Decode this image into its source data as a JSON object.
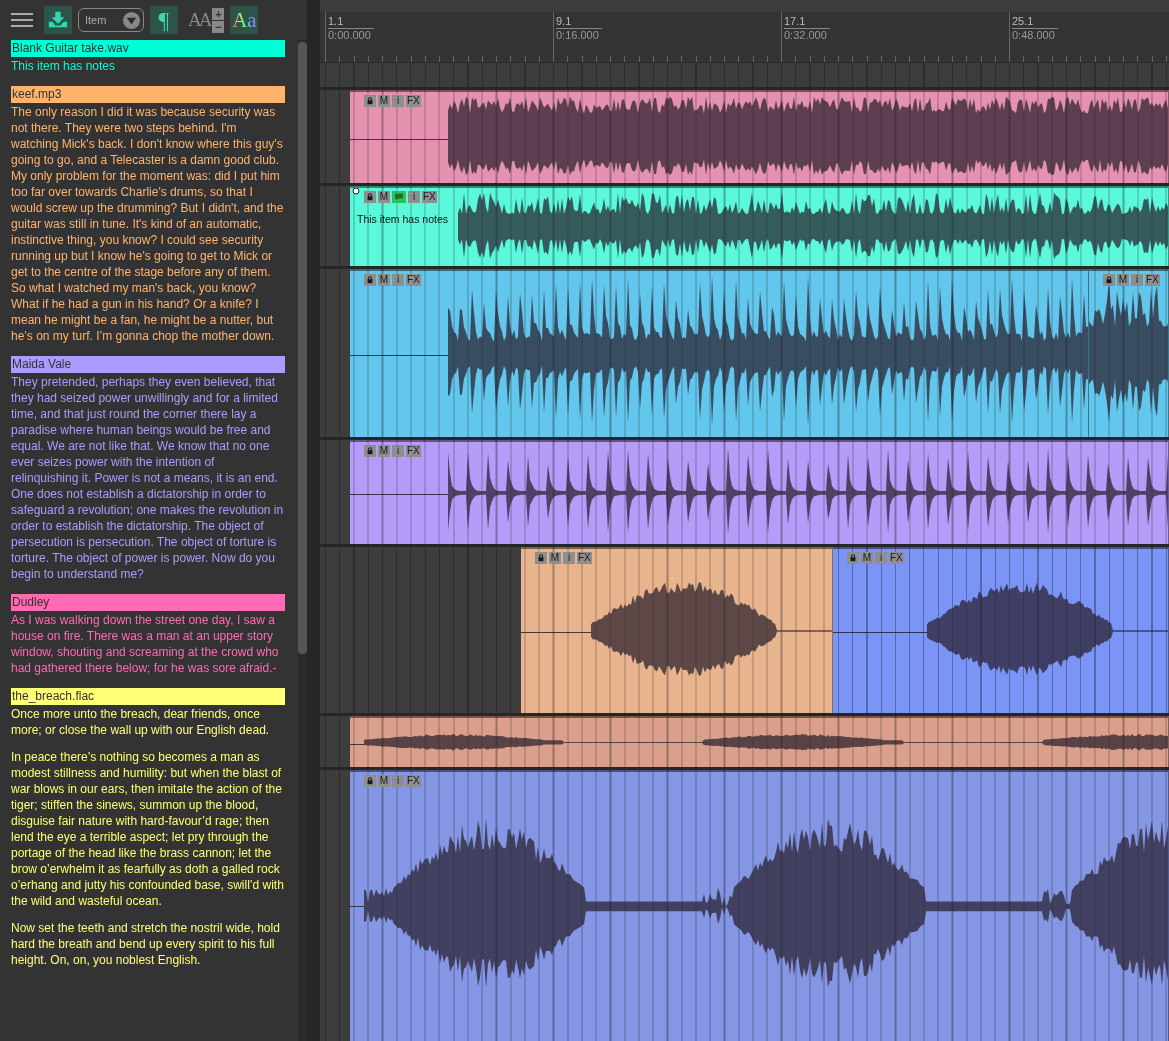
{
  "toolbar": {
    "dropdown": "Item",
    "pilcrow": "¶",
    "size_glyph": "AA",
    "increase": "+",
    "decrease": "−",
    "style_glyph": "Aa"
  },
  "notes": [
    {
      "title": "Blank Guitar take.wav",
      "color": "#00ffd8",
      "paragraphs": [
        "This item has notes"
      ]
    },
    {
      "title": "keef.mp3",
      "color": "#ffb46e",
      "paragraphs": [
        "The only reason I did it was because security was not there. They were two steps behind. I'm watching Mick's back. I don't know where this guy's going to go, and a Telecaster is a damn good club. My only problem for the moment was: did I put him too far over towards Charlie's drums, so that I would screw up the drumming? But I didn't, and the guitar was still in tune. It's kind of an automatic, instinctive thing, you know? I could see security running up but I know he's going to get to Mick or get to the centre of the stage before any of them. So what I watched my man's back, you know? What if he had a gun in his hand? Or a knife? I mean he might be a fan, he might be a nutter, but he’s on my turf. I’m gonna chop the mother down."
      ]
    },
    {
      "title": "Maida Vale",
      "color": "#aa9cff",
      "paragraphs": [
        "They pretended, perhaps they even believed, that they had seized power unwillingly and for a limited time, and that just round the corner there lay a paradise where human beings would be free and equal. We are not like that. We know that no one ever seizes power with the intention of relinquishing it. Power is not a means, it is an end. One does not establish a dictatorship in order to safeguard a revolution; one makes the revolution in order to establish the dictatorship. The object of persecution is persecution. The object of torture is torture. The object of power is power. Now do you begin to understand me?"
      ]
    },
    {
      "title": "Dudley",
      "color": "#ff6ab4",
      "paragraphs": [
        "As I was walking down the street one day, I saw a house on fire. There was a man at an upper story window, shouting and screaming at the crowd who had gathered there below; for he was sore afraid.-"
      ]
    },
    {
      "title": "the_breach.flac",
      "color": "#ffff78",
      "paragraphs": [
        "Once more unto the breach, dear friends, once more; or close the wall up with our English dead.",
        "In peace there’s nothing so becomes a man as modest stillness and humility: but when the blast of war blows in our ears, then imitate the action of the tiger; stiffen the sinews, summon up the blood, disguise fair nature with hard-favour’d rage; then lend the eye a terrible aspect; let pry through the portage of the head like the brass cannon; let the brow o’erwhelm it as fearfully as doth a galled rock o’erhang and jutty his confounded base, swill’d with the wild and wasteful ocean.",
        "Now set the teeth and stretch the nostril wide, hold hard the breath and bend up every spirit to his full height. On, on, you noblest English."
      ]
    }
  ],
  "ruler": [
    {
      "bar": "1.1",
      "time": "0:00.000"
    },
    {
      "bar": "9.1",
      "time": "0:16.000"
    },
    {
      "bar": "17.1",
      "time": "0:32.000"
    },
    {
      "bar": "25.1",
      "time": "0:48.000"
    }
  ],
  "tracks": [
    {
      "items": [
        {
          "color": "#e592b0",
          "buttons": [
            "M",
            "i",
            "FX"
          ],
          "notes": false
        }
      ]
    },
    {
      "items": [
        {
          "color": "#5cf8dc",
          "buttons": [
            "M",
            "i",
            "FX"
          ],
          "notes": true,
          "note_text": "This item has notes"
        }
      ]
    },
    {
      "items": [
        {
          "color": "#63c6ec",
          "buttons": [
            "M",
            "i",
            "FX"
          ],
          "notes": false
        },
        {
          "color": "#63c6ec",
          "buttons": [
            "M",
            "i",
            "FX"
          ],
          "notes": false
        }
      ]
    },
    {
      "items": [
        {
          "color": "#b59cf8",
          "buttons": [
            "M",
            "i",
            "FX"
          ],
          "notes": false
        }
      ]
    },
    {
      "items": [
        {
          "color": "#e8b48e",
          "buttons": [
            "M",
            "i",
            "FX"
          ],
          "notes": false
        },
        {
          "color": "#7b95f6",
          "buttons": [
            "M",
            "i",
            "FX"
          ],
          "notes": false
        }
      ]
    },
    {
      "items": [
        {
          "color": "#dba08c",
          "notes": false
        }
      ]
    },
    {
      "items": [
        {
          "color": "#8597e4",
          "buttons": [
            "M",
            "i",
            "FX"
          ],
          "notes": false
        }
      ]
    }
  ]
}
